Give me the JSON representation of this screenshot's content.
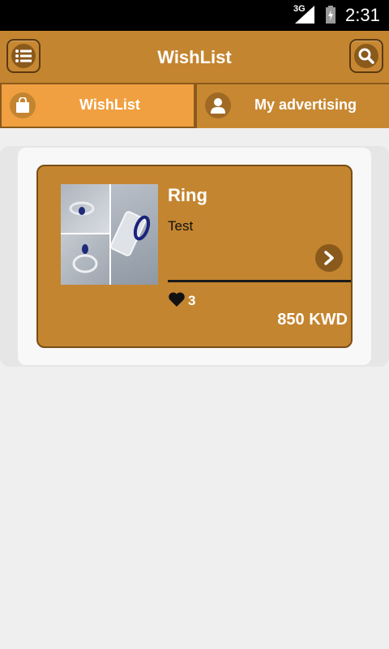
{
  "status_bar": {
    "network": "3G",
    "time": "2:31"
  },
  "header": {
    "title": "WishList",
    "menu_icon": "menu-list-icon",
    "search_icon": "search-icon"
  },
  "tabs": [
    {
      "label": "WishList",
      "icon": "shopping-bag-icon",
      "active": true
    },
    {
      "label": "My advertising",
      "icon": "user-icon",
      "active": false
    }
  ],
  "wishlist": {
    "items": [
      {
        "title": "Ring",
        "description": "Test",
        "likes": "3",
        "price": "850 KWD"
      }
    ]
  },
  "colors": {
    "header": "#c48530",
    "tab_active": "#f0a040",
    "card": "#c48530",
    "border_dark": "#8a5a1c"
  }
}
